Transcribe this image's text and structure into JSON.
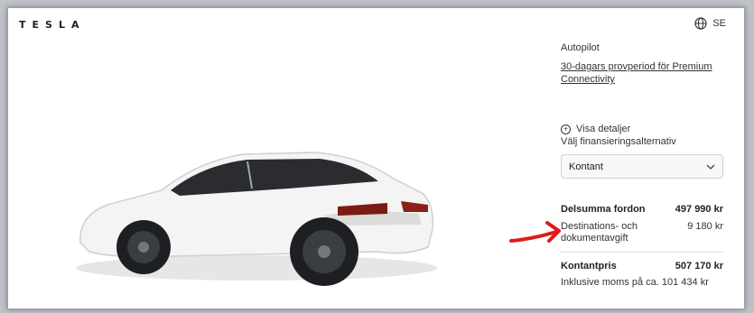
{
  "header": {
    "logo": "TESLA",
    "locale": "SE"
  },
  "icons": {
    "globe": "globe-icon",
    "plus_circle": "plus-circle-icon",
    "chevron": "chevron-down-icon",
    "arrow": "red-annotation-arrow"
  },
  "panel": {
    "autopilot": "Autopilot",
    "trial_link": "30-dagars provperiod för Premium Connectivity",
    "details_link": "Visa detaljer",
    "finance_label": "Välj finansieringsalternativ",
    "finance_select": "Kontant",
    "subtotal_label": "Delsumma fordon",
    "subtotal_value": "497 990 kr",
    "destination_label": "Destinations- och dokumentavgift",
    "destination_value": "9 180 kr",
    "cash_label": "Kontantpris",
    "cash_value": "507 170 kr",
    "vat_note": "Inklusive moms på ca. 101 434 kr"
  },
  "colors": {
    "annotation": "#e01a1a"
  }
}
